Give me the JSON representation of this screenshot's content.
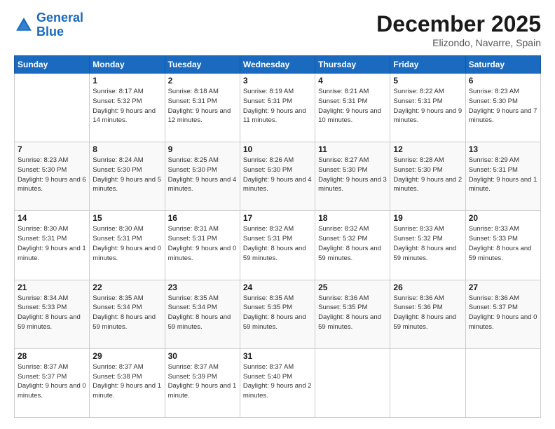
{
  "header": {
    "logo_general": "General",
    "logo_blue": "Blue",
    "month_title": "December 2025",
    "location": "Elizondo, Navarre, Spain"
  },
  "columns": [
    "Sunday",
    "Monday",
    "Tuesday",
    "Wednesday",
    "Thursday",
    "Friday",
    "Saturday"
  ],
  "weeks": [
    [
      {
        "day": "",
        "sunrise": "",
        "sunset": "",
        "daylight": ""
      },
      {
        "day": "1",
        "sunrise": "Sunrise: 8:17 AM",
        "sunset": "Sunset: 5:32 PM",
        "daylight": "Daylight: 9 hours and 14 minutes."
      },
      {
        "day": "2",
        "sunrise": "Sunrise: 8:18 AM",
        "sunset": "Sunset: 5:31 PM",
        "daylight": "Daylight: 9 hours and 12 minutes."
      },
      {
        "day": "3",
        "sunrise": "Sunrise: 8:19 AM",
        "sunset": "Sunset: 5:31 PM",
        "daylight": "Daylight: 9 hours and 11 minutes."
      },
      {
        "day": "4",
        "sunrise": "Sunrise: 8:21 AM",
        "sunset": "Sunset: 5:31 PM",
        "daylight": "Daylight: 9 hours and 10 minutes."
      },
      {
        "day": "5",
        "sunrise": "Sunrise: 8:22 AM",
        "sunset": "Sunset: 5:31 PM",
        "daylight": "Daylight: 9 hours and 9 minutes."
      },
      {
        "day": "6",
        "sunrise": "Sunrise: 8:23 AM",
        "sunset": "Sunset: 5:30 PM",
        "daylight": "Daylight: 9 hours and 7 minutes."
      }
    ],
    [
      {
        "day": "7",
        "sunrise": "Sunrise: 8:23 AM",
        "sunset": "Sunset: 5:30 PM",
        "daylight": "Daylight: 9 hours and 6 minutes."
      },
      {
        "day": "8",
        "sunrise": "Sunrise: 8:24 AM",
        "sunset": "Sunset: 5:30 PM",
        "daylight": "Daylight: 9 hours and 5 minutes."
      },
      {
        "day": "9",
        "sunrise": "Sunrise: 8:25 AM",
        "sunset": "Sunset: 5:30 PM",
        "daylight": "Daylight: 9 hours and 4 minutes."
      },
      {
        "day": "10",
        "sunrise": "Sunrise: 8:26 AM",
        "sunset": "Sunset: 5:30 PM",
        "daylight": "Daylight: 9 hours and 4 minutes."
      },
      {
        "day": "11",
        "sunrise": "Sunrise: 8:27 AM",
        "sunset": "Sunset: 5:30 PM",
        "daylight": "Daylight: 9 hours and 3 minutes."
      },
      {
        "day": "12",
        "sunrise": "Sunrise: 8:28 AM",
        "sunset": "Sunset: 5:30 PM",
        "daylight": "Daylight: 9 hours and 2 minutes."
      },
      {
        "day": "13",
        "sunrise": "Sunrise: 8:29 AM",
        "sunset": "Sunset: 5:31 PM",
        "daylight": "Daylight: 9 hours and 1 minute."
      }
    ],
    [
      {
        "day": "14",
        "sunrise": "Sunrise: 8:30 AM",
        "sunset": "Sunset: 5:31 PM",
        "daylight": "Daylight: 9 hours and 1 minute."
      },
      {
        "day": "15",
        "sunrise": "Sunrise: 8:30 AM",
        "sunset": "Sunset: 5:31 PM",
        "daylight": "Daylight: 9 hours and 0 minutes."
      },
      {
        "day": "16",
        "sunrise": "Sunrise: 8:31 AM",
        "sunset": "Sunset: 5:31 PM",
        "daylight": "Daylight: 9 hours and 0 minutes."
      },
      {
        "day": "17",
        "sunrise": "Sunrise: 8:32 AM",
        "sunset": "Sunset: 5:31 PM",
        "daylight": "Daylight: 8 hours and 59 minutes."
      },
      {
        "day": "18",
        "sunrise": "Sunrise: 8:32 AM",
        "sunset": "Sunset: 5:32 PM",
        "daylight": "Daylight: 8 hours and 59 minutes."
      },
      {
        "day": "19",
        "sunrise": "Sunrise: 8:33 AM",
        "sunset": "Sunset: 5:32 PM",
        "daylight": "Daylight: 8 hours and 59 minutes."
      },
      {
        "day": "20",
        "sunrise": "Sunrise: 8:33 AM",
        "sunset": "Sunset: 5:33 PM",
        "daylight": "Daylight: 8 hours and 59 minutes."
      }
    ],
    [
      {
        "day": "21",
        "sunrise": "Sunrise: 8:34 AM",
        "sunset": "Sunset: 5:33 PM",
        "daylight": "Daylight: 8 hours and 59 minutes."
      },
      {
        "day": "22",
        "sunrise": "Sunrise: 8:35 AM",
        "sunset": "Sunset: 5:34 PM",
        "daylight": "Daylight: 8 hours and 59 minutes."
      },
      {
        "day": "23",
        "sunrise": "Sunrise: 8:35 AM",
        "sunset": "Sunset: 5:34 PM",
        "daylight": "Daylight: 8 hours and 59 minutes."
      },
      {
        "day": "24",
        "sunrise": "Sunrise: 8:35 AM",
        "sunset": "Sunset: 5:35 PM",
        "daylight": "Daylight: 8 hours and 59 minutes."
      },
      {
        "day": "25",
        "sunrise": "Sunrise: 8:36 AM",
        "sunset": "Sunset: 5:35 PM",
        "daylight": "Daylight: 8 hours and 59 minutes."
      },
      {
        "day": "26",
        "sunrise": "Sunrise: 8:36 AM",
        "sunset": "Sunset: 5:36 PM",
        "daylight": "Daylight: 8 hours and 59 minutes."
      },
      {
        "day": "27",
        "sunrise": "Sunrise: 8:36 AM",
        "sunset": "Sunset: 5:37 PM",
        "daylight": "Daylight: 9 hours and 0 minutes."
      }
    ],
    [
      {
        "day": "28",
        "sunrise": "Sunrise: 8:37 AM",
        "sunset": "Sunset: 5:37 PM",
        "daylight": "Daylight: 9 hours and 0 minutes."
      },
      {
        "day": "29",
        "sunrise": "Sunrise: 8:37 AM",
        "sunset": "Sunset: 5:38 PM",
        "daylight": "Daylight: 9 hours and 1 minute."
      },
      {
        "day": "30",
        "sunrise": "Sunrise: 8:37 AM",
        "sunset": "Sunset: 5:39 PM",
        "daylight": "Daylight: 9 hours and 1 minute."
      },
      {
        "day": "31",
        "sunrise": "Sunrise: 8:37 AM",
        "sunset": "Sunset: 5:40 PM",
        "daylight": "Daylight: 9 hours and 2 minutes."
      },
      {
        "day": "",
        "sunrise": "",
        "sunset": "",
        "daylight": ""
      },
      {
        "day": "",
        "sunrise": "",
        "sunset": "",
        "daylight": ""
      },
      {
        "day": "",
        "sunrise": "",
        "sunset": "",
        "daylight": ""
      }
    ]
  ]
}
